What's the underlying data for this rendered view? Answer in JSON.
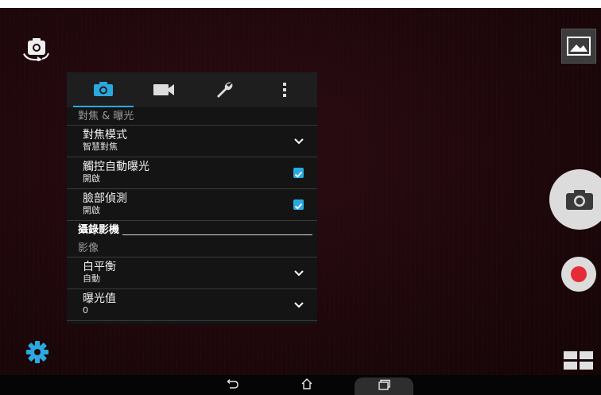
{
  "settings_panel": {
    "tabs": [
      {
        "name": "camera-tab",
        "icon": "camera-icon",
        "active": true
      },
      {
        "name": "video-tab",
        "icon": "video-camera-icon",
        "active": false
      },
      {
        "name": "tools-tab",
        "icon": "wrench-icon",
        "active": false
      },
      {
        "name": "more-tab",
        "icon": "more-vertical-icon",
        "active": false
      }
    ],
    "focus_section": "對焦 & 曝光",
    "rows": [
      {
        "title": "對焦模式",
        "value": "智慧對焦",
        "control": "dropdown"
      },
      {
        "title": "觸控自動曝光",
        "value": "開啟",
        "control": "checkbox",
        "checked": true
      },
      {
        "title": "臉部偵測",
        "value": "開啟",
        "control": "checkbox",
        "checked": true
      }
    ],
    "video_header": "攝錄影機",
    "image_section": "影像",
    "image_rows": [
      {
        "title": "白平衡",
        "value": "自動",
        "control": "dropdown"
      },
      {
        "title": "曝光值",
        "value": "0",
        "control": "dropdown"
      }
    ]
  },
  "colors": {
    "accent": "#29a9e0",
    "record": "#e52b35",
    "panel_bg": "#141414"
  },
  "icons": {
    "switch_camera": "switch-camera-icon",
    "settings": "gear-icon",
    "gallery": "gallery-icon",
    "shutter": "camera-icon",
    "record": "record-icon",
    "modes": "mode-grid-icon",
    "back": "back-icon",
    "home": "home-icon",
    "recent": "recent-apps-icon"
  }
}
